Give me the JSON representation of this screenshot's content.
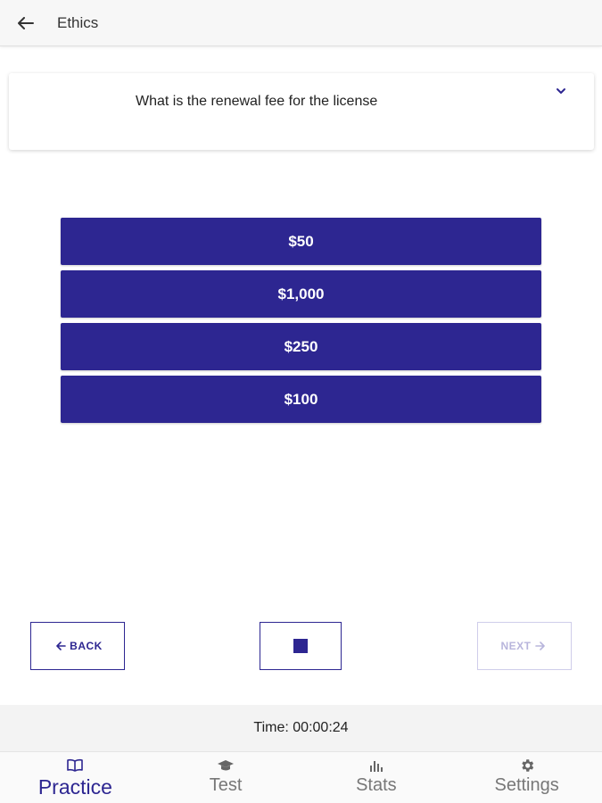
{
  "header": {
    "title": "Ethics",
    "back_icon": "arrow-left-icon"
  },
  "question": {
    "text": "What is the renewal fee for the license",
    "expand_icon": "chevron-down-icon"
  },
  "answers": [
    {
      "label": "$50"
    },
    {
      "label": "$1,000"
    },
    {
      "label": "$250"
    },
    {
      "label": "$100"
    }
  ],
  "navigation": {
    "back_label": "BACK",
    "next_label": "NEXT",
    "stop_icon": "stop-icon"
  },
  "timer": {
    "text": "Time: 00:00:24"
  },
  "tabs": [
    {
      "label": "Practice",
      "icon": "book-icon",
      "active": true
    },
    {
      "label": "Test",
      "icon": "graduation-cap-icon",
      "active": false
    },
    {
      "label": "Stats",
      "icon": "bar-chart-icon",
      "active": false
    },
    {
      "label": "Settings",
      "icon": "gear-icon",
      "active": false
    }
  ],
  "colors": {
    "accent": "#2d2691",
    "disabled": "#b8b5dc"
  }
}
